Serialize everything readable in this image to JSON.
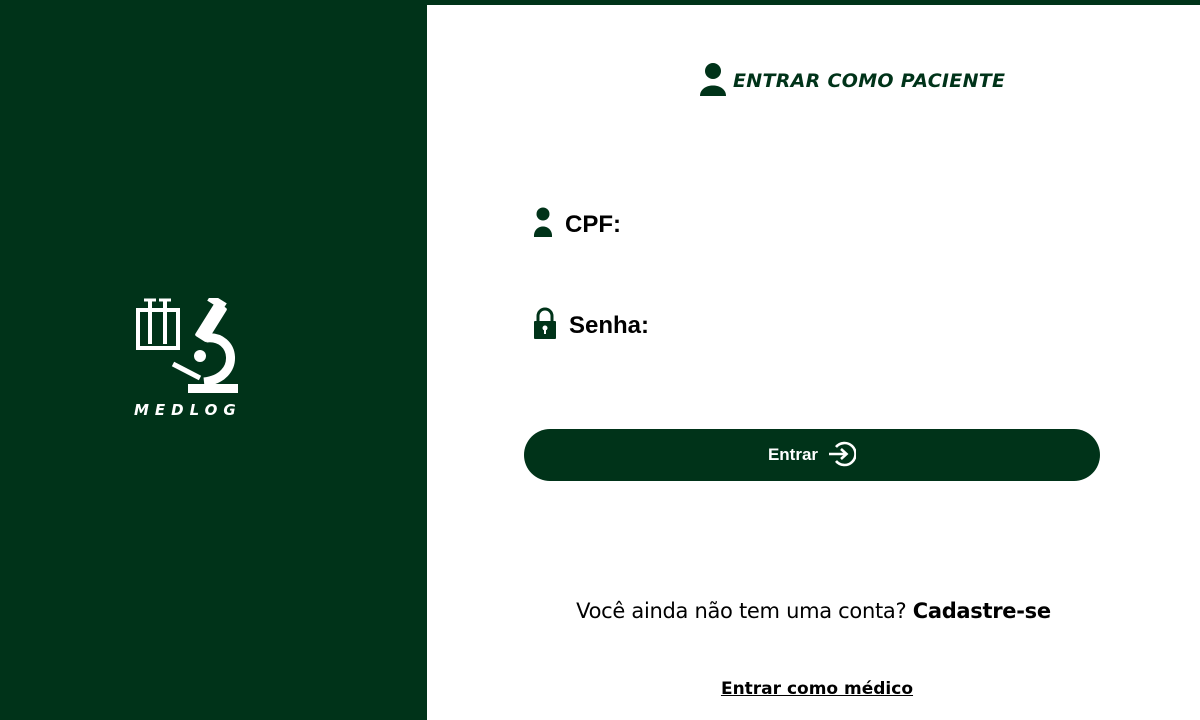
{
  "brand": {
    "name": "MEDLOG",
    "logo_icon": "microscope-test-tubes-icon"
  },
  "colors": {
    "primary": "#003319",
    "background": "#ffffff",
    "text": "#000000"
  },
  "login": {
    "heading": "ENTRAR COMO PACIENTE",
    "heading_icon": "user-icon",
    "cpf_label": "CPF:",
    "cpf_icon": "user-icon",
    "cpf_value": "",
    "password_label": "Senha:",
    "password_icon": "lock-icon",
    "password_value": "",
    "submit_label": "Entrar",
    "submit_icon": "sign-in-icon"
  },
  "signup": {
    "prompt": "Você ainda não tem uma conta?",
    "link_label": "Cadastre-se"
  },
  "alt_login": {
    "doctor_link": "Entrar como médico"
  }
}
